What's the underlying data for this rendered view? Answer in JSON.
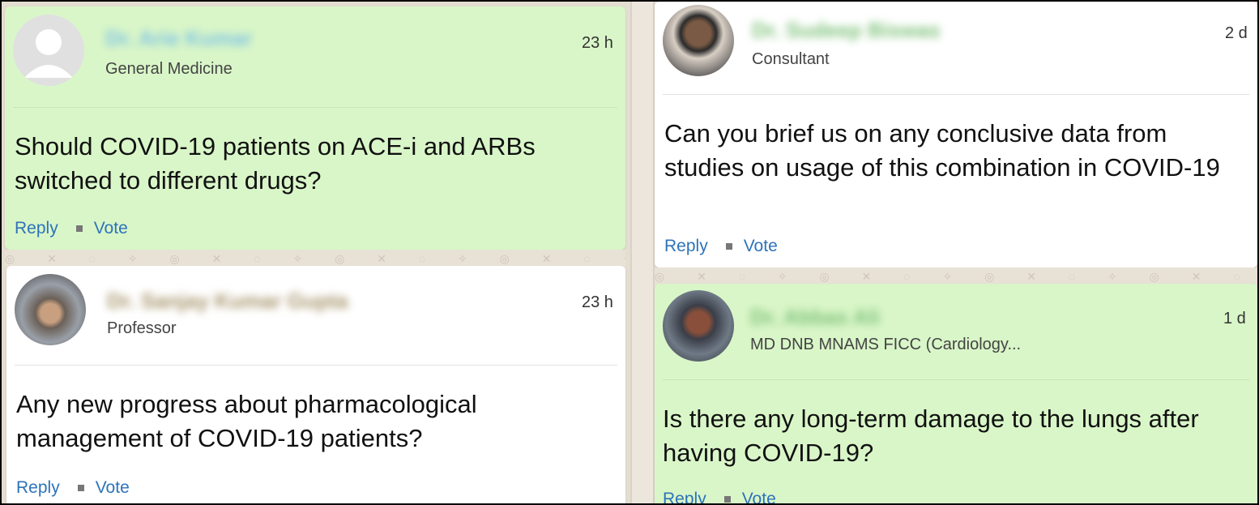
{
  "posts": [
    {
      "author": "Dr. Arie Kumar",
      "role": "General Medicine",
      "time": "23 h",
      "question": "Should COVID-19 patients on ACE-i and ARBs switched to different drugs?",
      "reply_label": "Reply",
      "vote_label": "Vote",
      "background": "#d9f6c8"
    },
    {
      "author": "Dr. Sanjay Kumar Gupta",
      "role": "Professor",
      "time": "23 h",
      "question": "Any new progress about pharmacological management of COVID-19 patients?",
      "reply_label": "Reply",
      "vote_label": "Vote",
      "background": "#ffffff"
    },
    {
      "author": "Dr. Sudeep Biswas",
      "role": "Consultant",
      "time": "2 d",
      "question": "Can you brief us on any conclusive data from studies on usage of this combination in COVID-19",
      "reply_label": "Reply",
      "vote_label": "Vote",
      "background": "#ffffff"
    },
    {
      "author": "Dr. Abbas Ali",
      "role": "MD DNB MNAMS FICC (Cardiology...",
      "time": "1 d",
      "question": "Is there any long-term damage to the lungs after having COVID-19?",
      "reply_label": "Reply",
      "vote_label": "Vote",
      "background": "#d9f6c8"
    }
  ],
  "colors": {
    "link": "#2d73b9",
    "name_blur": "#7fc27a",
    "name_blur_dark": "#a7946a"
  },
  "icons": {
    "avatar_placeholder": "user-silhouette-icon",
    "bullet": "square-dot-icon"
  }
}
